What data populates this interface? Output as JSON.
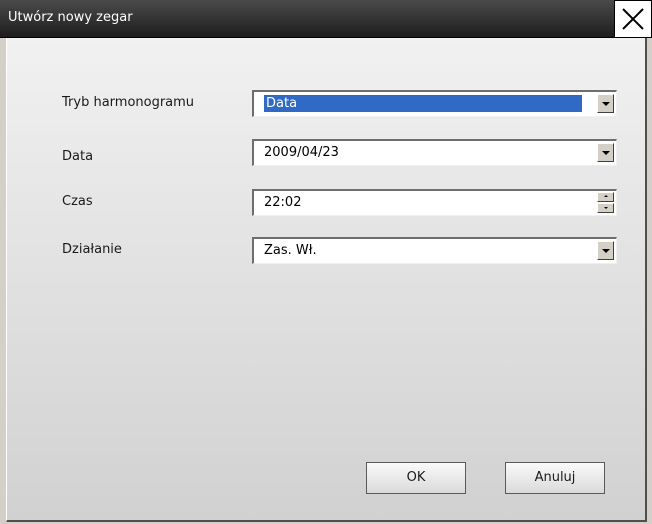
{
  "window": {
    "title": "Utwórz nowy zegar"
  },
  "form": {
    "schedule_mode": {
      "label": "Tryb harmonogramu",
      "value": "Data"
    },
    "date": {
      "label": "Data",
      "value": "2009/04/23"
    },
    "time": {
      "label": "Czas",
      "value": "22:02"
    },
    "action": {
      "label": "Działanie",
      "value": "Zas. Wł."
    }
  },
  "buttons": {
    "ok_label": "OK",
    "cancel_label": "Anuluj"
  },
  "icons": {
    "close": "close-icon",
    "dropdown": "chevron-down-icon",
    "spin_up": "spin-up-icon",
    "spin_down": "spin-down-icon"
  },
  "colors": {
    "selection": "#316ac5",
    "titlebar": "#2b2b2b"
  }
}
